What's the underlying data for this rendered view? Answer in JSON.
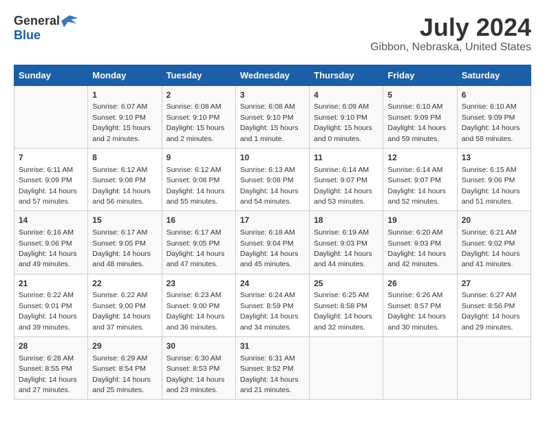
{
  "header": {
    "logo_general": "General",
    "logo_blue": "Blue",
    "title": "July 2024",
    "subtitle": "Gibbon, Nebraska, United States"
  },
  "days_of_week": [
    "Sunday",
    "Monday",
    "Tuesday",
    "Wednesday",
    "Thursday",
    "Friday",
    "Saturday"
  ],
  "weeks": [
    [
      {
        "day": "",
        "detail": ""
      },
      {
        "day": "1",
        "detail": "Sunrise: 6:07 AM\nSunset: 9:10 PM\nDaylight: 15 hours\nand 2 minutes."
      },
      {
        "day": "2",
        "detail": "Sunrise: 6:08 AM\nSunset: 9:10 PM\nDaylight: 15 hours\nand 2 minutes."
      },
      {
        "day": "3",
        "detail": "Sunrise: 6:08 AM\nSunset: 9:10 PM\nDaylight: 15 hours\nand 1 minute."
      },
      {
        "day": "4",
        "detail": "Sunrise: 6:09 AM\nSunset: 9:10 PM\nDaylight: 15 hours\nand 0 minutes."
      },
      {
        "day": "5",
        "detail": "Sunrise: 6:10 AM\nSunset: 9:09 PM\nDaylight: 14 hours\nand 59 minutes."
      },
      {
        "day": "6",
        "detail": "Sunrise: 6:10 AM\nSunset: 9:09 PM\nDaylight: 14 hours\nand 58 minutes."
      }
    ],
    [
      {
        "day": "7",
        "detail": "Sunrise: 6:11 AM\nSunset: 9:09 PM\nDaylight: 14 hours\nand 57 minutes."
      },
      {
        "day": "8",
        "detail": "Sunrise: 6:12 AM\nSunset: 9:08 PM\nDaylight: 14 hours\nand 56 minutes."
      },
      {
        "day": "9",
        "detail": "Sunrise: 6:12 AM\nSunset: 9:08 PM\nDaylight: 14 hours\nand 55 minutes."
      },
      {
        "day": "10",
        "detail": "Sunrise: 6:13 AM\nSunset: 9:08 PM\nDaylight: 14 hours\nand 54 minutes."
      },
      {
        "day": "11",
        "detail": "Sunrise: 6:14 AM\nSunset: 9:07 PM\nDaylight: 14 hours\nand 53 minutes."
      },
      {
        "day": "12",
        "detail": "Sunrise: 6:14 AM\nSunset: 9:07 PM\nDaylight: 14 hours\nand 52 minutes."
      },
      {
        "day": "13",
        "detail": "Sunrise: 6:15 AM\nSunset: 9:06 PM\nDaylight: 14 hours\nand 51 minutes."
      }
    ],
    [
      {
        "day": "14",
        "detail": "Sunrise: 6:16 AM\nSunset: 9:06 PM\nDaylight: 14 hours\nand 49 minutes."
      },
      {
        "day": "15",
        "detail": "Sunrise: 6:17 AM\nSunset: 9:05 PM\nDaylight: 14 hours\nand 48 minutes."
      },
      {
        "day": "16",
        "detail": "Sunrise: 6:17 AM\nSunset: 9:05 PM\nDaylight: 14 hours\nand 47 minutes."
      },
      {
        "day": "17",
        "detail": "Sunrise: 6:18 AM\nSunset: 9:04 PM\nDaylight: 14 hours\nand 45 minutes."
      },
      {
        "day": "18",
        "detail": "Sunrise: 6:19 AM\nSunset: 9:03 PM\nDaylight: 14 hours\nand 44 minutes."
      },
      {
        "day": "19",
        "detail": "Sunrise: 6:20 AM\nSunset: 9:03 PM\nDaylight: 14 hours\nand 42 minutes."
      },
      {
        "day": "20",
        "detail": "Sunrise: 6:21 AM\nSunset: 9:02 PM\nDaylight: 14 hours\nand 41 minutes."
      }
    ],
    [
      {
        "day": "21",
        "detail": "Sunrise: 6:22 AM\nSunset: 9:01 PM\nDaylight: 14 hours\nand 39 minutes."
      },
      {
        "day": "22",
        "detail": "Sunrise: 6:22 AM\nSunset: 9:00 PM\nDaylight: 14 hours\nand 37 minutes."
      },
      {
        "day": "23",
        "detail": "Sunrise: 6:23 AM\nSunset: 9:00 PM\nDaylight: 14 hours\nand 36 minutes."
      },
      {
        "day": "24",
        "detail": "Sunrise: 6:24 AM\nSunset: 8:59 PM\nDaylight: 14 hours\nand 34 minutes."
      },
      {
        "day": "25",
        "detail": "Sunrise: 6:25 AM\nSunset: 8:58 PM\nDaylight: 14 hours\nand 32 minutes."
      },
      {
        "day": "26",
        "detail": "Sunrise: 6:26 AM\nSunset: 8:57 PM\nDaylight: 14 hours\nand 30 minutes."
      },
      {
        "day": "27",
        "detail": "Sunrise: 6:27 AM\nSunset: 8:56 PM\nDaylight: 14 hours\nand 29 minutes."
      }
    ],
    [
      {
        "day": "28",
        "detail": "Sunrise: 6:28 AM\nSunset: 8:55 PM\nDaylight: 14 hours\nand 27 minutes."
      },
      {
        "day": "29",
        "detail": "Sunrise: 6:29 AM\nSunset: 8:54 PM\nDaylight: 14 hours\nand 25 minutes."
      },
      {
        "day": "30",
        "detail": "Sunrise: 6:30 AM\nSunset: 8:53 PM\nDaylight: 14 hours\nand 23 minutes."
      },
      {
        "day": "31",
        "detail": "Sunrise: 6:31 AM\nSunset: 8:52 PM\nDaylight: 14 hours\nand 21 minutes."
      },
      {
        "day": "",
        "detail": ""
      },
      {
        "day": "",
        "detail": ""
      },
      {
        "day": "",
        "detail": ""
      }
    ]
  ]
}
